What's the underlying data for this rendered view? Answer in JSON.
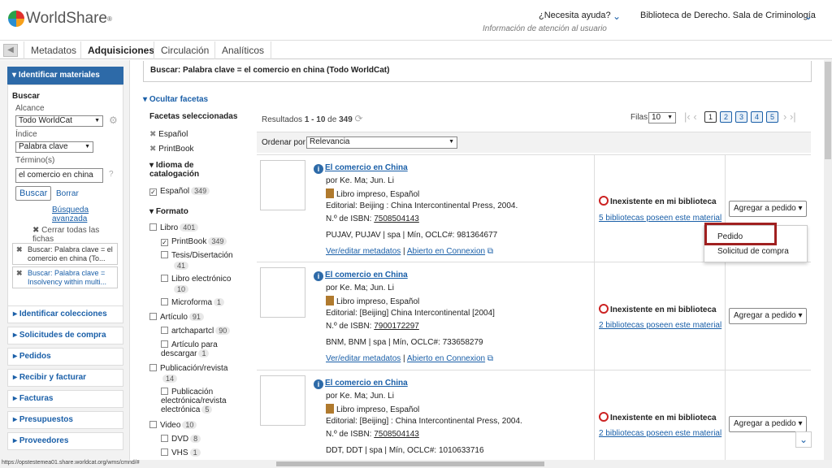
{
  "header": {
    "logo_text": "WorldShare",
    "help_text": "¿Necesita ayuda?",
    "help_sub": "Información de atención al usuario",
    "library": "Biblioteca de Derecho. Sala de Criminología"
  },
  "tabs": [
    "Metadatos",
    "Adquisiciones",
    "Circulación",
    "Analíticos"
  ],
  "sidebar": {
    "head": "Identificar materiales",
    "buscar": "Buscar",
    "alcance_label": "Alcance",
    "alcance_value": "Todo WorldCat",
    "indice_label": "Índice",
    "indice_value": "Palabra clave",
    "termino_label": "Término(s)",
    "termino_value": "el comercio en china",
    "search_btn": "Buscar",
    "clear_btn": "Borrar",
    "advanced": "Búsqueda avanzada",
    "close_all": "Cerrar todas las fichas",
    "chip1": "Buscar: Palabra clave = el comercio en china (To...",
    "chip2": "Buscar: Palabra clave = Insolvency within multi...",
    "links": [
      "Identificar colecciones",
      "Solicitudes de compra",
      "Pedidos",
      "Recibir y facturar",
      "Facturas",
      "Presupuestos",
      "Proveedores"
    ]
  },
  "search_summary": "Buscar: Palabra clave = el comercio en china (Todo WorldCat)",
  "facets": {
    "hide": "Ocultar facetas",
    "selected_title": "Facetas seleccionadas",
    "selected": [
      "Español",
      "PrintBook"
    ],
    "lang_title": "Idioma de catalogación",
    "lang_item": "Español",
    "lang_count": "349",
    "format_title": "Formato",
    "formats": [
      {
        "label": "Libro",
        "count": "401"
      },
      {
        "label": "PrintBook",
        "count": "349"
      },
      {
        "label": "Tesis/Disertación",
        "count": "41"
      },
      {
        "label": "Libro electrónico",
        "count": "10"
      },
      {
        "label": "Microforma",
        "count": "1"
      },
      {
        "label": "Artículo",
        "count": "91"
      },
      {
        "label": "artchapartcl",
        "count": "90"
      },
      {
        "label": "Artículo para descargar",
        "count": "1"
      },
      {
        "label": "Publicación/revista",
        "count": "14"
      },
      {
        "label": "Publicación electrónica/revista electrónica",
        "count": "5"
      },
      {
        "label": "Video",
        "count": "10"
      },
      {
        "label": "DVD",
        "count": "8"
      },
      {
        "label": "VHS",
        "count": "1"
      }
    ]
  },
  "results": {
    "label": "Resultados",
    "range": "1 - 10",
    "of": "de",
    "total": "349",
    "rows_label": "Filas",
    "rows_value": "10",
    "pages": [
      "1",
      "2",
      "3",
      "4",
      "5"
    ],
    "sort_label": "Ordenar por",
    "sort_value": "Relevancia"
  },
  "items": [
    {
      "title": "El comercio en China",
      "author": "por Ke. Ma; Jun. Li",
      "format": "Libro impreso, Español",
      "publisher": "Editorial: Beijing : China Intercontinental Press, 2004.",
      "isbn_label": "N.º de ISBN:",
      "isbn": "7508504143",
      "codes": "PUJAV, PUJAV",
      "lang": "spa",
      "oclc": "Mín, OCLC#: 981364677",
      "edit": "Ver/editar metadatos",
      "open": "Abierto en Connexion",
      "status": "Inexistente en mi biblioteca",
      "holdings": "5 bibliotecas poseen este material",
      "add": "Agregar a pedido"
    },
    {
      "title": "El comercio en China",
      "author": "por Ke. Ma; Jun. Li",
      "format": "Libro impreso, Español",
      "publisher": "Editorial: [Beijing] China Intercontinental [2004]",
      "isbn_label": "N.º de ISBN:",
      "isbn": "7900172297",
      "codes": "BNM, BNM",
      "lang": "spa",
      "oclc": "Mín, OCLC#: 733658279",
      "edit": "Ver/editar metadatos",
      "open": "Abierto en Connexion",
      "status": "Inexistente en mi biblioteca",
      "holdings": "2 bibliotecas poseen este material",
      "add": "Agregar a pedido"
    },
    {
      "title": "El comercio en China",
      "author": "por Ke. Ma; Jun. Li",
      "format": "Libro impreso, Español",
      "publisher": "Editorial: [Beijing] : China Intercontinental Press, 2004.",
      "isbn_label": "N.º de ISBN:",
      "isbn": "7508504143",
      "codes": "DDT, DDT",
      "lang": "spa",
      "oclc": "Mín, OCLC#: 1010633716",
      "status": "Inexistente en mi biblioteca",
      "holdings": "2 bibliotecas poseen este material",
      "add": "Agregar a pedido"
    }
  ],
  "dropdown": [
    "Pedido",
    "Solicitud de compra"
  ],
  "status_url": "https://opstestemea01.share.worldcat.org/wms/cmnd/#"
}
